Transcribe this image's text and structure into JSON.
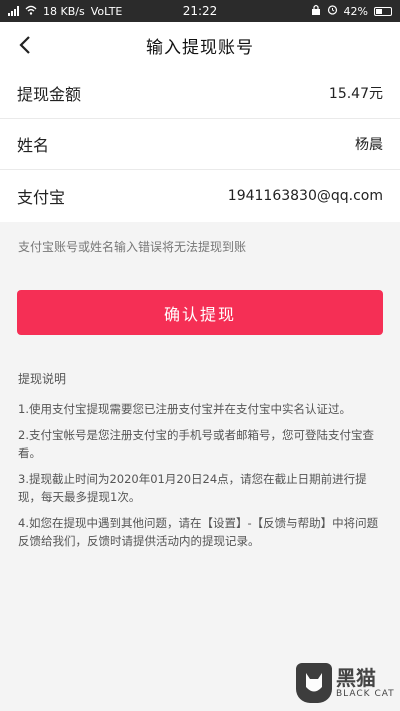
{
  "status_bar": {
    "net_speed": "18 KB/s",
    "carrier": "VoLTE",
    "time": "21:22",
    "battery": "42%"
  },
  "header": {
    "title": "输入提现账号"
  },
  "form": {
    "amount": {
      "label": "提现金额",
      "value": "15.47元"
    },
    "name": {
      "label": "姓名",
      "value": "杨晨"
    },
    "alipay": {
      "label": "支付宝",
      "value": "1941163830@qq.com"
    }
  },
  "warning": "支付宝账号或姓名输入错误将无法提现到账",
  "confirm_button": "确认提现",
  "notes": {
    "title": "提现说明",
    "items": [
      "1.使用支付宝提现需要您已注册支付宝并在支付宝中实名认证过。",
      "2.支付宝帐号是您注册支付宝的手机号或者邮箱号，您可登陆支付宝查看。",
      "3.提现截止时间为2020年01月20日24点，请您在截止日期前进行提现，每天最多提现1次。",
      "4.如您在提现中遇到其他问题，请在【设置】-【反馈与帮助】中将问题反馈给我们，反馈时请提供活动内的提现记录。"
    ]
  },
  "watermark": {
    "cn": "黑猫",
    "en": "BLACK CAT"
  },
  "colors": {
    "accent": "#f52f55",
    "background": "#f4f4f4",
    "status_bar": "#2b2b2b"
  }
}
